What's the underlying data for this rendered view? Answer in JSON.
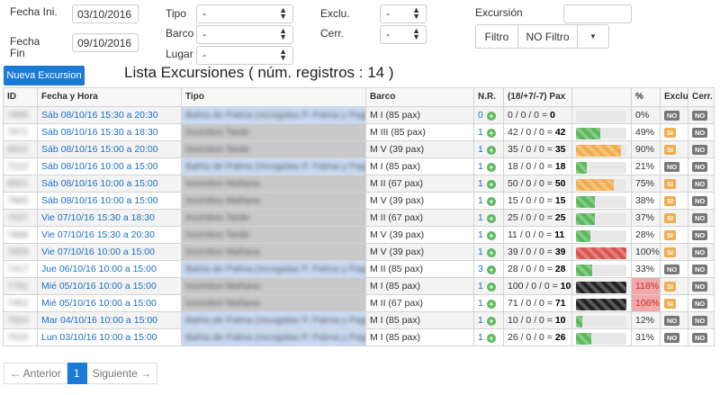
{
  "filters": {
    "fecha_ini_label": "Fecha Ini.",
    "fecha_fin_label": "Fecha Fin",
    "fecha_ini_value": "03/10/2016",
    "fecha_fin_value": "09/10/2016",
    "tipo_label": "Tipo",
    "barco_label": "Barco",
    "lugar_label": "Lugar",
    "tipo_value": "-",
    "barco_value": "-",
    "lugar_value": "-",
    "exclu_label": "Exclu.",
    "cerr_label": "Cerr.",
    "exclu_value": "-",
    "cerr_value": "-",
    "excursion_label": "Excursión",
    "excursion_value": "",
    "filtro_button": "Filtro",
    "no_filtro_button": "NO Filtro"
  },
  "actions": {
    "new_button": "Nueva Excursion"
  },
  "list_title": "Lista Excursiones ( núm. registros : 14 )",
  "columns": [
    "ID",
    "Fecha y Hora",
    "Tipo",
    "Barco",
    "N.R.",
    "(18/+7/-7) Pax",
    "",
    "%",
    "Exclu.",
    "Cerr."
  ],
  "colors": {
    "accent": "#1a7bd6",
    "green": "#5cb85c",
    "orange": "#f0ad4e",
    "red": "#d9534f",
    "black": "#222222"
  },
  "rows": [
    {
      "id": "7895",
      "date": "Sáb 08/10/16 15:30 a 20:30",
      "tipo": "Bahía de Palma (recogidas P. Palma y Paguera)",
      "tipo_color": "blue",
      "barco": "M I (85 pax)",
      "nr": "0",
      "pax_expr": "0 / 0 / 0 = ",
      "pax_total": "0",
      "fill": 0,
      "bar_color": "green",
      "pct": "0%",
      "exclu": "NO",
      "cerr": "NO"
    },
    {
      "id": "7871",
      "date": "Sáb 08/10/16 15:30 a 18:30",
      "tipo": "Incentivo Tarde",
      "tipo_color": "grey",
      "barco": "M III (85 pax)",
      "nr": "1",
      "pax_expr": "42 / 0 / 0 = ",
      "pax_total": "42",
      "fill": 0.49,
      "bar_color": "green",
      "pct": "49%",
      "exclu": "SI",
      "cerr": "NO"
    },
    {
      "id": "8822",
      "date": "Sáb 08/10/16 15:00 a 20:00",
      "tipo": "Incentivo Tarde",
      "tipo_color": "grey",
      "barco": "M V (39 pax)",
      "nr": "1",
      "pax_expr": "35 / 0 / 0 = ",
      "pax_total": "35",
      "fill": 0.9,
      "bar_color": "orange",
      "pct": "90%",
      "exclu": "SI",
      "cerr": "NO"
    },
    {
      "id": "7222",
      "date": "Sáb 08/10/16 10:00 a 15:00",
      "tipo": "Bahía de Palma (recogidas P. Palma y Paguera)",
      "tipo_color": "blue",
      "barco": "M I (85 pax)",
      "nr": "1",
      "pax_expr": "18 / 0 / 0 = ",
      "pax_total": "18",
      "fill": 0.21,
      "bar_color": "green",
      "pct": "21%",
      "exclu": "NO",
      "cerr": "NO"
    },
    {
      "id": "8001",
      "date": "Sáb 08/10/16 10:00 a 15:00",
      "tipo": "Incentivo Mañana",
      "tipo_color": "grey",
      "barco": "M II (67 pax)",
      "nr": "1",
      "pax_expr": "50 / 0 / 0 = ",
      "pax_total": "50",
      "fill": 0.75,
      "bar_color": "orange",
      "pct": "75%",
      "exclu": "SI",
      "cerr": "NO"
    },
    {
      "id": "7885",
      "date": "Sáb 08/10/16 10:00 a 15:00",
      "tipo": "Incentivo Mañana",
      "tipo_color": "grey",
      "barco": "M V (39 pax)",
      "nr": "1",
      "pax_expr": "15 / 0 / 0 = ",
      "pax_total": "15",
      "fill": 0.38,
      "bar_color": "green",
      "pct": "38%",
      "exclu": "SI",
      "cerr": "NO"
    },
    {
      "id": "7037",
      "date": "Vie 07/10/16 15:30 a 18:30",
      "tipo": "Incentivo Tarde",
      "tipo_color": "grey",
      "barco": "M II (67 pax)",
      "nr": "1",
      "pax_expr": "25 / 0 / 0 = ",
      "pax_total": "25",
      "fill": 0.37,
      "bar_color": "green",
      "pct": "37%",
      "exclu": "SI",
      "cerr": "NO"
    },
    {
      "id": "7888",
      "date": "Vie 07/10/16 15:30 a 20:30",
      "tipo": "Incentivo Tarde",
      "tipo_color": "grey",
      "barco": "M V (39 pax)",
      "nr": "1",
      "pax_expr": "11 / 0 / 0 = ",
      "pax_total": "11",
      "fill": 0.28,
      "bar_color": "green",
      "pct": "28%",
      "exclu": "SI",
      "cerr": "NO"
    },
    {
      "id": "7859",
      "date": "Vie 07/10/16 10:00 a 15:00",
      "tipo": "Incentivo Mañana",
      "tipo_color": "grey",
      "barco": "M V (39 pax)",
      "nr": "1",
      "pax_expr": "39 / 0 / 0 = ",
      "pax_total": "39",
      "fill": 1.0,
      "bar_color": "red",
      "pct": "100%",
      "exclu": "SI",
      "cerr": "NO"
    },
    {
      "id": "7417",
      "date": "Jue 06/10/16 10:00 a 15:00",
      "tipo": "Bahía de Palma (recogidas P. Palma y Paguera)",
      "tipo_color": "blue",
      "barco": "M II (85 pax)",
      "nr": "3",
      "pax_expr": "28 / 0 / 0 = ",
      "pax_total": "28",
      "fill": 0.33,
      "bar_color": "green",
      "pct": "33%",
      "exclu": "NO",
      "cerr": "NO"
    },
    {
      "id": "7781",
      "date": "Mié 05/10/16 10:00 a 15:00",
      "tipo": "Incentivo Mañana",
      "tipo_color": "grey",
      "barco": "M I (85 pax)",
      "nr": "1",
      "pax_expr": "100 / 0 / 0 = ",
      "pax_total": "100",
      "fill": 1.0,
      "bar_color": "black",
      "pct": "118%",
      "pct_red": true,
      "exclu": "SI",
      "cerr": "NO"
    },
    {
      "id": "7452",
      "date": "Mié 05/10/16 10:00 a 15:00",
      "tipo": "Incentivo Mañana",
      "tipo_color": "grey",
      "barco": "M II (67 pax)",
      "nr": "1",
      "pax_expr": "71 / 0 / 0 = ",
      "pax_total": "71",
      "fill": 1.0,
      "bar_color": "black",
      "pct": "106%",
      "pct_red": true,
      "exclu": "SI",
      "cerr": "NO"
    },
    {
      "id": "7024",
      "date": "Mar 04/10/16 10:00 a 15:00",
      "tipo": "Bahía de Palma (recogidas P. Palma y Paguera)",
      "tipo_color": "blue",
      "barco": "M I (85 pax)",
      "nr": "1",
      "pax_expr": "10 / 0 / 0 = ",
      "pax_total": "10",
      "fill": 0.12,
      "bar_color": "green",
      "pct": "12%",
      "exclu": "NO",
      "cerr": "NO"
    },
    {
      "id": "7020",
      "date": "Lun 03/10/16 10:00 a 15:00",
      "tipo": "Bahía de Palma (recogidas P. Palma y Paguera)",
      "tipo_color": "blue",
      "barco": "M I (85 pax)",
      "nr": "1",
      "pax_expr": "26 / 0 / 0 = ",
      "pax_total": "26",
      "fill": 0.31,
      "bar_color": "green",
      "pct": "31%",
      "exclu": "NO",
      "cerr": "NO"
    }
  ],
  "pager": {
    "prev": "← Anterior",
    "current": "1",
    "next": "Siguiente →"
  }
}
